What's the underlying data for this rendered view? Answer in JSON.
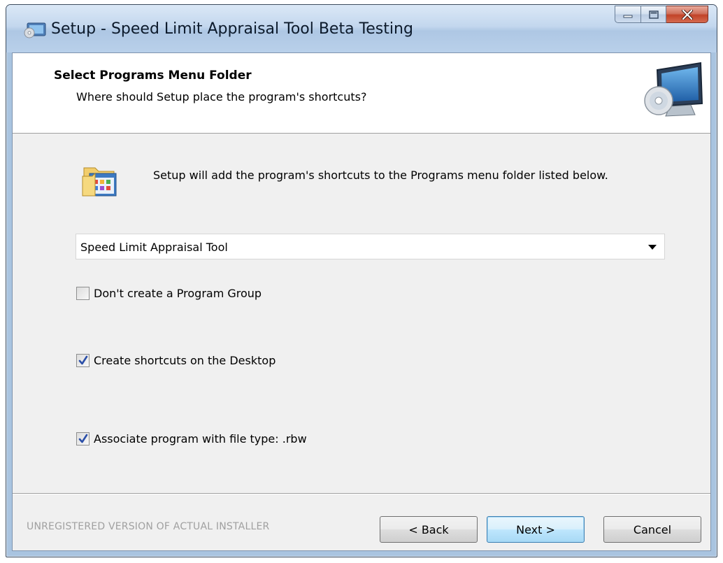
{
  "window": {
    "title": "Setup - Speed Limit Appraisal Tool Beta Testing"
  },
  "header": {
    "title": "Select Programs Menu Folder",
    "subtitle": "Where should Setup place the program's shortcuts?"
  },
  "body": {
    "description": "Setup will add the program's shortcuts to the Programs menu folder listed below."
  },
  "folder_select": {
    "value": "Speed Limit Appraisal Tool"
  },
  "options": [
    {
      "label": "Don't create a Program Group",
      "checked": false
    },
    {
      "label": "Create shortcuts on the Desktop",
      "checked": true
    },
    {
      "label": "Associate program with file type: .rbw",
      "checked": true
    }
  ],
  "footer": {
    "unregistered_text": "UNREGISTERED VERSION OF ACTUAL INSTALLER",
    "back_label": "< Back",
    "next_label": "Next >",
    "cancel_label": "Cancel"
  }
}
